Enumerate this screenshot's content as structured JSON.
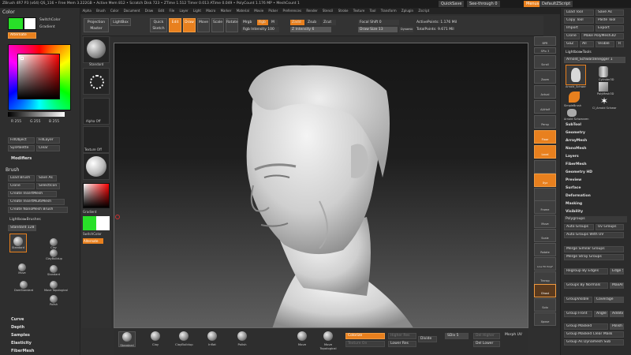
{
  "title_bar": {
    "text": "ZBrush 4R7 P3 (x64)   QS_116   • Free Mem 3.222GB • Active Mem 812 • Scratch Disk 723 • ZTime 1.512 Timer 0.013 ATime 0.049 • PolyCount 1.176 MP • MeshCount 1",
    "quicksave": "QuickSave",
    "see_through": "See-through 0",
    "menus_label": "Menus",
    "default_script": "DefaultZScript"
  },
  "menu_bar": [
    "Alpha",
    "Brush",
    "Color",
    "Document",
    "Draw",
    "Edit",
    "File",
    "Layer",
    "Light",
    "Macro",
    "Marker",
    "Material",
    "Movie",
    "Picker",
    "Preferences",
    "Render",
    "Stencil",
    "Stroke",
    "Texture",
    "Tool",
    "Transform",
    "Zplugin",
    "Zscript"
  ],
  "toolbar": {
    "projection_master": "Projection Master",
    "lightbox": "LightBox",
    "quick_sketch": "Quick Sketch",
    "edit": "Edit",
    "draw": "Draw",
    "move": "Move",
    "scale": "Scale",
    "rotate": "Rotate",
    "mrgb": "Mrgb",
    "rgb": "Rgb",
    "m": "M",
    "rgb_intensity": "Rgb Intensity 100",
    "zadd": "Zadd",
    "zsub": "Zsub",
    "zcut": "Zcut",
    "z_intensity": "Z Intensity 6",
    "focal_shift": "Focal Shift 0",
    "draw_size": "Draw Size 13",
    "dynamic": "Dynamic",
    "active_points": "ActivePoints: 1.176 Mil",
    "total_points": "TotalPoints: 9.671 Mil"
  },
  "left_panel": {
    "color_title": "Color",
    "switch_color": "SwitchColor",
    "gradient": "Gradient",
    "alternate": "Alternate",
    "rgb_values": [
      "R 255",
      "G 255",
      "B 255"
    ],
    "fill_object": "FillObject",
    "fill_layer": "FillLayer",
    "sys_palette": "SysPalette",
    "clear": "Clear",
    "modifiers": "Modifiers",
    "brush_title": "Brush",
    "load_brush": "Load Brush",
    "save_as": "Save As",
    "clone": "Clone",
    "selection": "SelectIcon",
    "create_insert_mesh": "Create InsertMesh",
    "create_insert_multi": "Create InsertMultiMesh",
    "create_nano": "Create NanoMesh Brush",
    "lightbox_brushes": "Lightbox▸Brushes",
    "standard_count": "Standard 128",
    "brushes": [
      {
        "name": "Standard"
      },
      {
        "name": "Clay"
      },
      {
        "name": "ClayBuildup"
      },
      {
        "name": "Standard"
      },
      {
        "name": "Move"
      },
      {
        "name": "Move Topological"
      },
      {
        "name": "DamStandard"
      },
      {
        "name": "Polish"
      }
    ],
    "sections": [
      "Curve",
      "Depth",
      "Samples",
      "Elasticity",
      "FiberMesh"
    ]
  },
  "shelf": {
    "labels": [
      "Standard",
      "",
      "Alpha Off",
      "Texture Off",
      "",
      "",
      "Gradient",
      "SwitchColor",
      "Alternate"
    ]
  },
  "right_shelf": [
    "BPR",
    "SPix 3",
    "Scroll",
    "Zoom",
    "Actual",
    "AAHalf",
    "Persp",
    "Floor",
    "Local",
    "",
    "Xyz",
    "",
    "Frame",
    "Move",
    "Scale",
    "Rotate",
    "Line Fill PolyF",
    "",
    "Transp",
    "Ghost",
    "",
    "Solo",
    "Xpose"
  ],
  "right_panel": {
    "load_tool": "Load Tool",
    "save_as": "Save As",
    "copy_tool": "Copy Tool",
    "paste_tool": "Paste Tool",
    "import": "Import",
    "export": "Export",
    "clone": "Clone",
    "make_polymesh": "Make PolyMesh3D",
    "goz": "GoZ",
    "all": "All",
    "visible": "Visible",
    "r": "R",
    "lightbox_tools": "Lightbox▸Tools",
    "current_tool": "Arnold_Schwarzenegger 1",
    "tool_items": [
      {
        "name": "Arnold_Schwar"
      },
      {
        "name": "Cylinder3D"
      },
      {
        "name": "SimpleBrush"
      },
      {
        "name": "PolyMesh3D"
      },
      {
        "name": "SimpleBrush"
      },
      {
        "name": "Cl_Arnold Schwar"
      },
      {
        "name": "Arnold Schwarzen"
      }
    ],
    "menu_items": [
      "SubTool",
      "Geometry",
      "ArrayMesh",
      "NanoMesh",
      "Layers",
      "FiberMesh",
      "Geometry HD",
      "Preview",
      "Surface",
      "Deformation",
      "Masking",
      "Visibility",
      "Polygroups"
    ],
    "polygroup_buttons": [
      "Auto Groups",
      "Uv Groups",
      "Auto Groups With UV",
      "Merge Similar Groups",
      "Merge Stray Groups",
      "Regroup By Edges",
      "Edge 5",
      "Groups By Normals",
      "MaxAngle",
      "GroupVisible",
      "Coverage",
      "Group Front",
      "Angle",
      "Additional",
      "Group Masked",
      "Polish",
      "Group Masked Clear Mask",
      "Group As Dynamesh Sub"
    ]
  },
  "bottom_shelf": {
    "brushes": [
      "Standard",
      "Clay",
      "ClayBuildup",
      "Inflat",
      "Polish",
      "Move",
      "Move Topological"
    ],
    "colorize": "Colorize",
    "texture_on": "Texture On",
    "higher_res": "Higher Res",
    "lower_res": "Lower Res",
    "divide": "Divide",
    "sdiv": "SDiv 5",
    "del_higher": "Del Higher",
    "del_lower": "Del Lower",
    "morph_uv": "Morph UV"
  },
  "colors": {
    "accent": "#e8801e",
    "panel_bg": "#2e2e2e",
    "viewport_top": "#161616",
    "viewport_bottom": "#5e5e5e"
  }
}
